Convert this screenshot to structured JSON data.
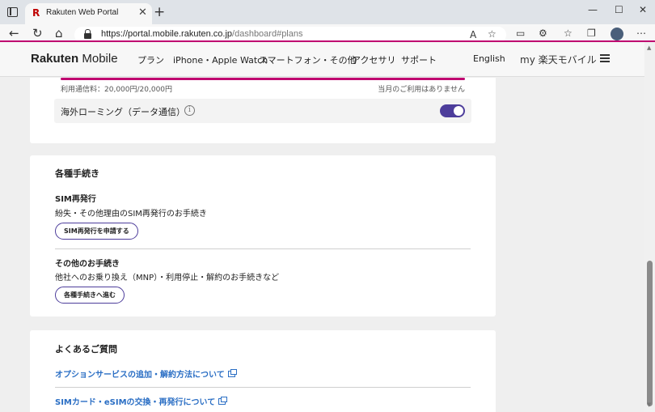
{
  "browser": {
    "tab_title": "Rakuten Web Portal",
    "tab_favicon": "R",
    "url_host": "https://portal.mobile.rakuten.co.jp",
    "url_path": "/dashboard#plans",
    "window_buttons": [
      "—",
      "☐",
      "✕"
    ]
  },
  "header": {
    "logo_bold": "Rakuten",
    "logo_light": "Mobile",
    "nav": [
      "プラン",
      "iPhone・Apple Watch",
      "スマートフォン・その他",
      "アクセサリ",
      "サポート"
    ],
    "language": "English",
    "my_title": "my 楽天モバイル"
  },
  "usage": {
    "label": "利用通信料：20,000円/20,000円",
    "note": "当月のご利用はありません",
    "progress_fraction": 1.0
  },
  "roaming": {
    "label": "海外ローミング（データ通信）",
    "info_icon": "i",
    "enabled": true
  },
  "procedures": {
    "title": "各種手続き",
    "sim": {
      "title": "SIM再発行",
      "desc": "紛失・その他理由のSIM再発行のお手続き",
      "button": "SIM再発行を申請する"
    },
    "other": {
      "title": "その他のお手続き",
      "desc": "他社へのお乗り換え（MNP）・利用停止・解約のお手続きなど",
      "button": "各種手続きへ進む"
    }
  },
  "faq": {
    "title": "よくあるご質問",
    "links": [
      "オプションサービスの追加・解約方法について",
      "SIMカード・eSIMの交換・再発行について"
    ]
  },
  "colors": {
    "brand_pink": "#bf0070",
    "accent_purple": "#4d3d9b",
    "link_blue": "#2a6ec4"
  }
}
